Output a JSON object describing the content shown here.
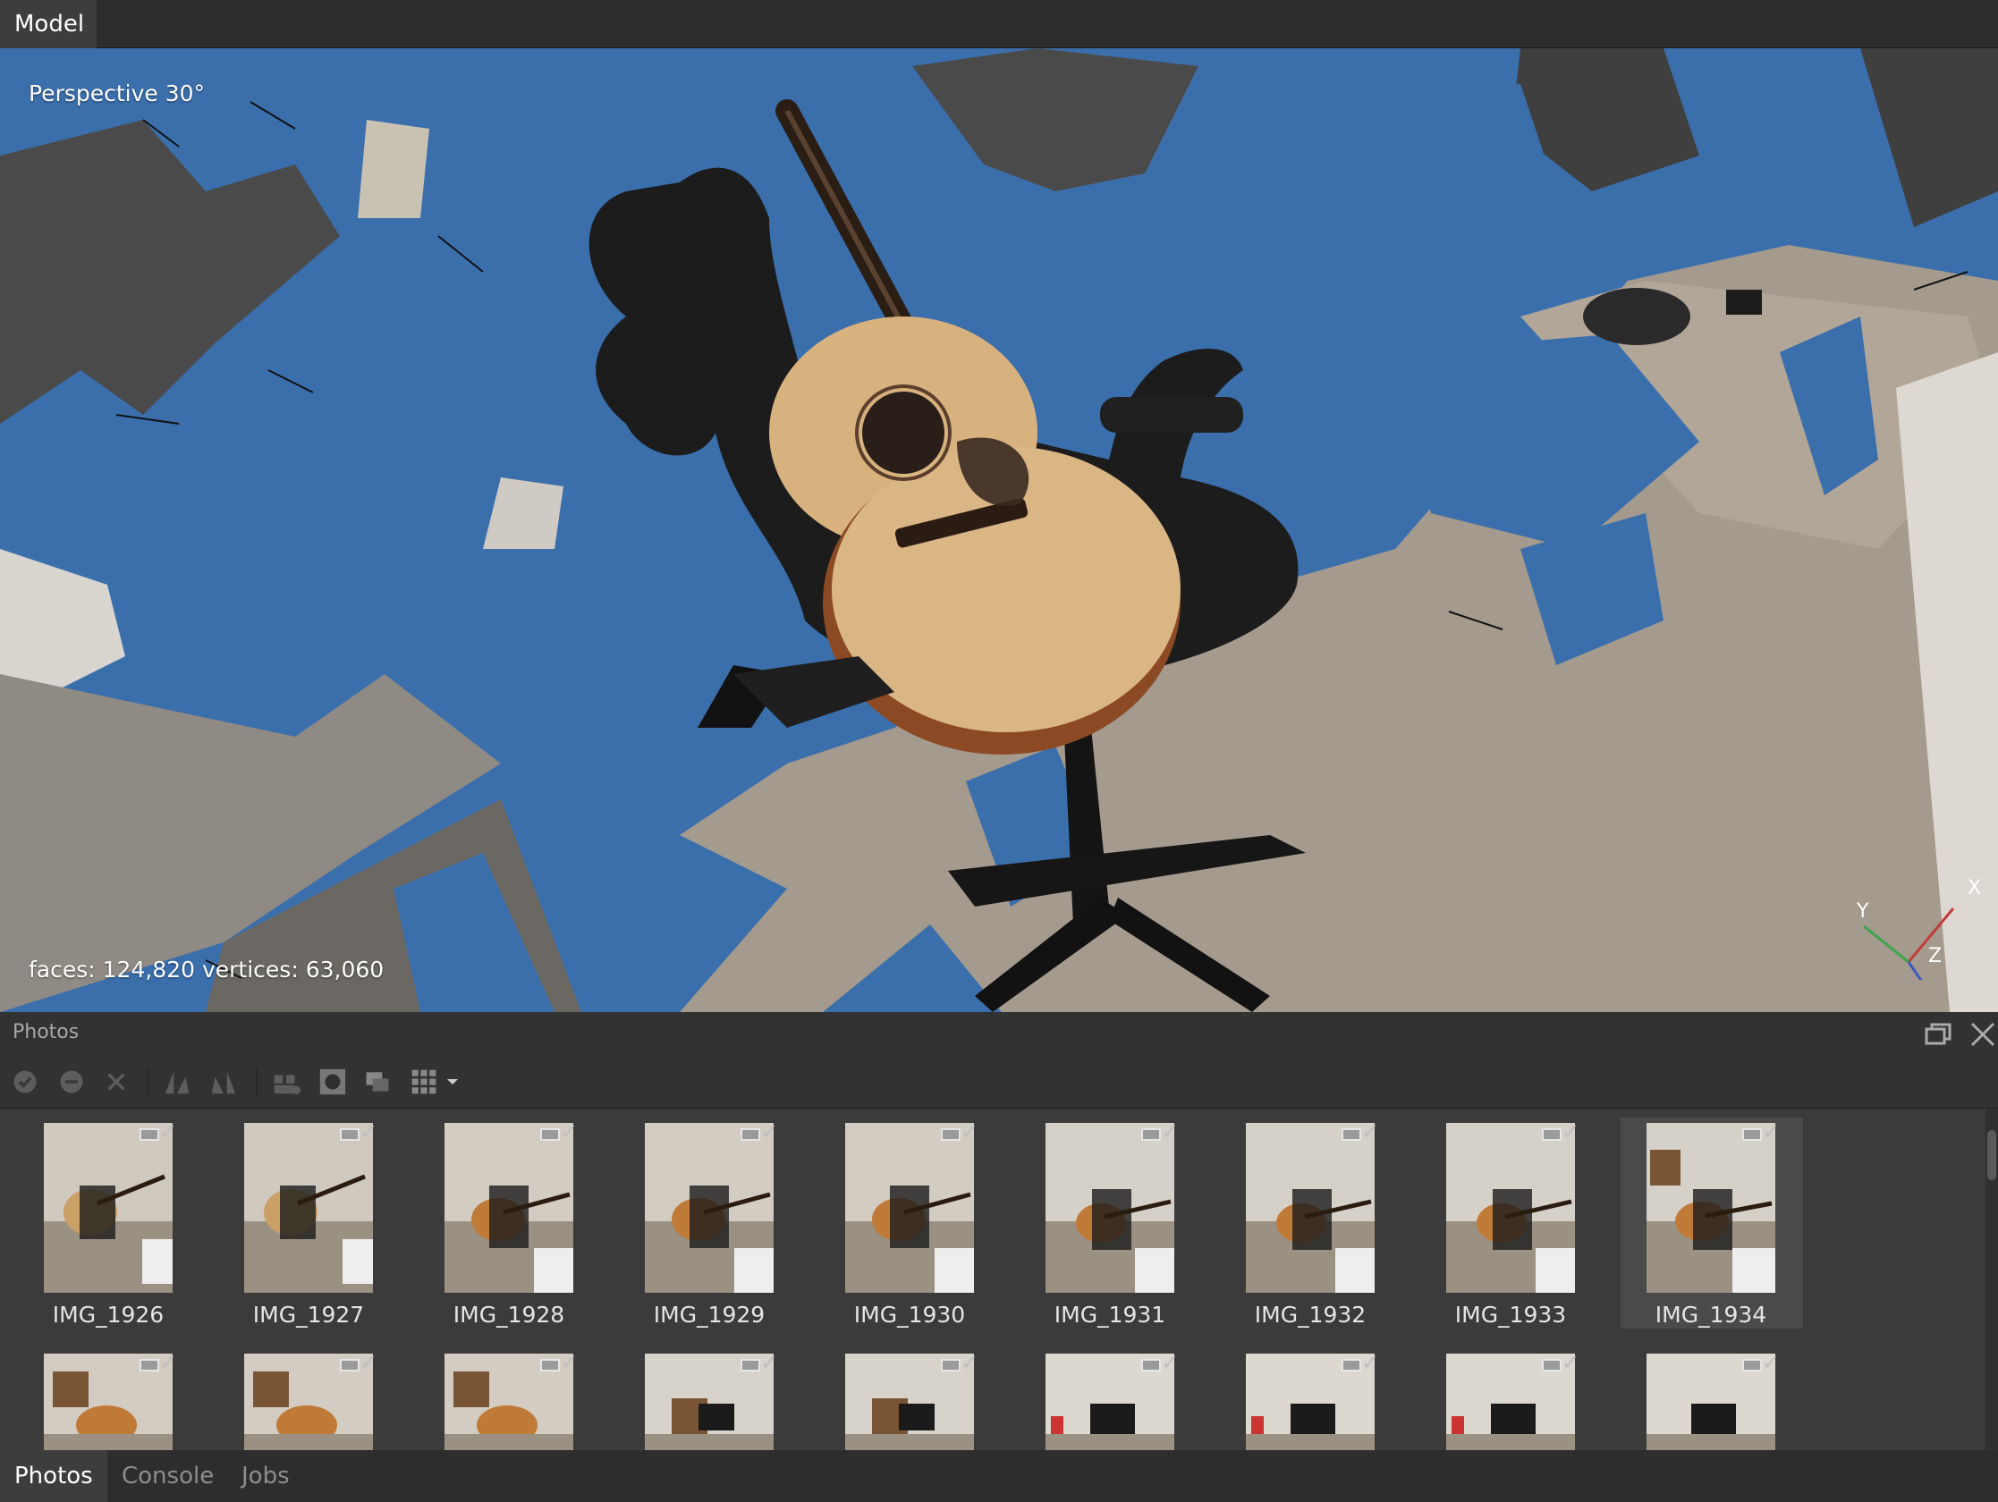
{
  "top_tab": {
    "label": "Model"
  },
  "viewport": {
    "projection": "Perspective 30°",
    "stats": "faces: 124,820 vertices: 63,060",
    "axes": {
      "x": "X",
      "y": "Y",
      "z": "Z"
    }
  },
  "photos_panel": {
    "title": "Photos",
    "toolbar_icons": [
      "check-icon",
      "minus-icon",
      "close-icon",
      "rotate-left-icon",
      "rotate-right-icon",
      "align-icon",
      "mask-icon",
      "overlap-icon",
      "view-mode-icon",
      "chevron-down-icon"
    ],
    "photos_row1": [
      "IMG_1926",
      "IMG_1927",
      "IMG_1928",
      "IMG_1929",
      "IMG_1930",
      "IMG_1931",
      "IMG_1932",
      "IMG_1933",
      "IMG_1934"
    ],
    "photos_row2": [
      "",
      "",
      "",
      "",
      "",
      "",
      "",
      "",
      ""
    ],
    "selected": "IMG_1934"
  },
  "bottom_tabs": [
    {
      "label": "Photos",
      "active": true
    },
    {
      "label": "Console",
      "active": false
    },
    {
      "label": "Jobs",
      "active": false
    }
  ],
  "colors": {
    "viewport_blue": "#3b6fac",
    "panel_bg": "#3a3a3a"
  }
}
